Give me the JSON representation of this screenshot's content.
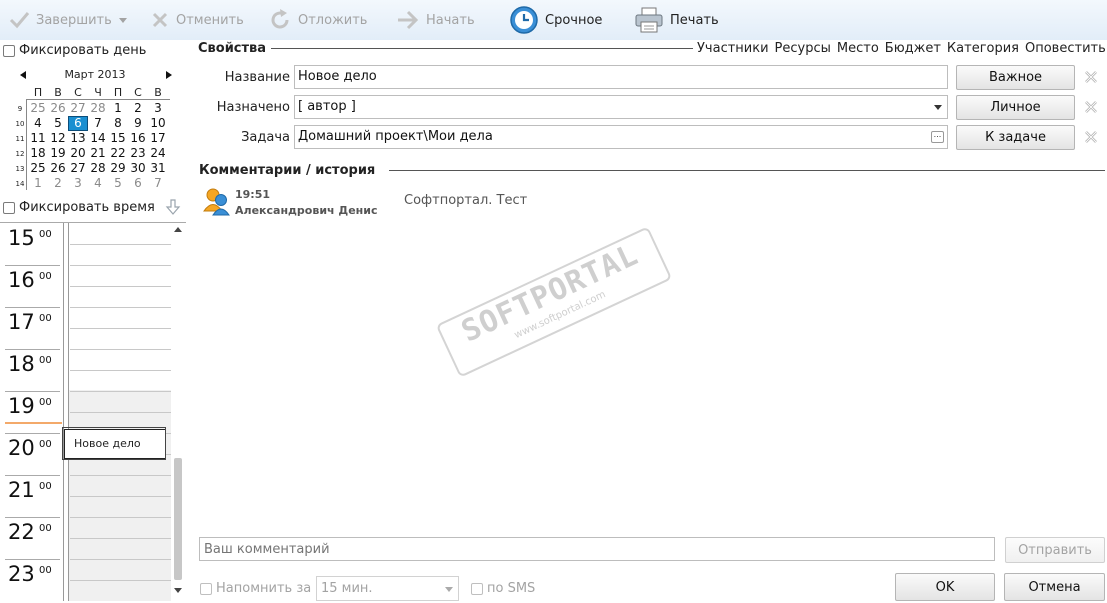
{
  "toolbar": {
    "complete": "Завершить",
    "cancel": "Отменить",
    "postpone": "Отложить",
    "start": "Начать",
    "urgent": "Срочное",
    "print": "Печать"
  },
  "left": {
    "fix_day": "Фиксировать день",
    "fix_time": "Фиксировать время",
    "calendar": {
      "month_title": "Март 2013",
      "weekdays": [
        "П",
        "В",
        "С",
        "Ч",
        "П",
        "С",
        "В"
      ],
      "weeks": [
        "9",
        "10",
        "11",
        "12",
        "13",
        "14"
      ],
      "days": [
        [
          "25",
          "26",
          "27",
          "28",
          "1",
          "2",
          "3"
        ],
        [
          "4",
          "5",
          "6",
          "7",
          "8",
          "9",
          "10"
        ],
        [
          "11",
          "12",
          "13",
          "14",
          "15",
          "16",
          "17"
        ],
        [
          "18",
          "19",
          "20",
          "21",
          "22",
          "23",
          "24"
        ],
        [
          "25",
          "26",
          "27",
          "28",
          "29",
          "30",
          "31"
        ],
        [
          "1",
          "2",
          "3",
          "4",
          "5",
          "6",
          "7"
        ]
      ]
    },
    "hours": [
      "15",
      "16",
      "17",
      "18",
      "19",
      "20",
      "21",
      "22",
      "23"
    ],
    "minutes": "00",
    "event_title": "Новое дело"
  },
  "properties": {
    "title": "Свойства",
    "tabs": [
      "Участники",
      "Ресурсы",
      "Место",
      "Бюджет",
      "Категория",
      "Оповестить"
    ],
    "name_label": "Название",
    "name_value": "Новое дело",
    "assigned_label": "Назначено",
    "assigned_value": "[ автор ]",
    "task_label": "Задача",
    "task_value": "Домашний проект\\Мои дела",
    "important_btn": "Важное",
    "personal_btn": "Личное",
    "to_task_btn": "К задаче"
  },
  "comments": {
    "title": "Комментарии / история",
    "items": [
      {
        "time": "19:51",
        "author": "Александрович Денис",
        "text": "Софтпортал. Тест"
      }
    ],
    "placeholder": "Ваш комментарий",
    "send": "Отправить"
  },
  "footer": {
    "remind_label": "Напомнить за",
    "remind_value": "15 мин.",
    "sms_label": "по SMS",
    "ok": "OK",
    "cancel": "Отмена"
  },
  "watermark": {
    "brand": "SOFTPORTAL",
    "url": "www.softportal.com"
  },
  "colors": {
    "toolbar_bg": "#e8f1fb",
    "accent_blue": "#1a8fd1",
    "disabled_text": "#a3a3a3"
  }
}
